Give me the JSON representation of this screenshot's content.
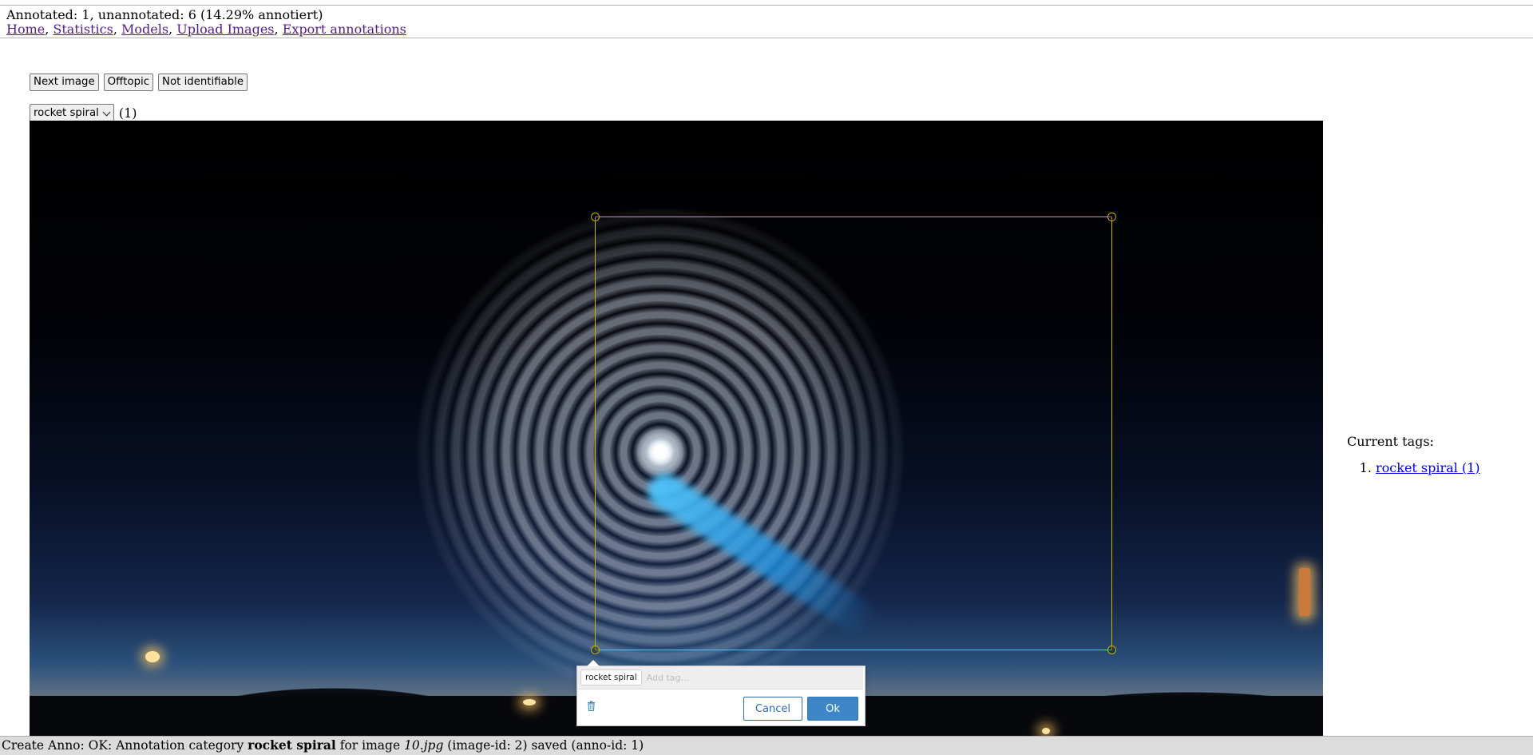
{
  "header": {
    "status": "Annotated: 1, unannotated: 6 (14.29% annotiert)"
  },
  "nav": {
    "items": [
      {
        "label": "Home"
      },
      {
        "label": "Statistics"
      },
      {
        "label": "Models"
      },
      {
        "label": "Upload Images"
      },
      {
        "label": "Export annotations"
      }
    ],
    "separator": ", "
  },
  "toolbar": {
    "next_label": "Next image",
    "offtopic_label": "Offtopic",
    "not_identifiable_label": "Not identifiable"
  },
  "category": {
    "selected": "rocket spiral",
    "count": "(1)"
  },
  "popup": {
    "tag": "rocket spiral",
    "add_tag_placeholder": "Add tag...",
    "cancel_label": "Cancel",
    "ok_label": "Ok",
    "trash_icon": "trash-icon"
  },
  "tags_panel": {
    "title": "Current tags:",
    "items": [
      {
        "label": "rocket spiral (1)"
      }
    ]
  },
  "footer": {
    "prefix": "Create Anno: OK: Annotation category ",
    "category": "rocket spiral",
    "mid": " for image ",
    "image": "10.jpg",
    "suffix": " (image-id: 2) saved (anno-id: 1)"
  },
  "colors": {
    "bbox": "#c9b200",
    "ok_button": "#3f86c9",
    "link": "#551a8b"
  }
}
